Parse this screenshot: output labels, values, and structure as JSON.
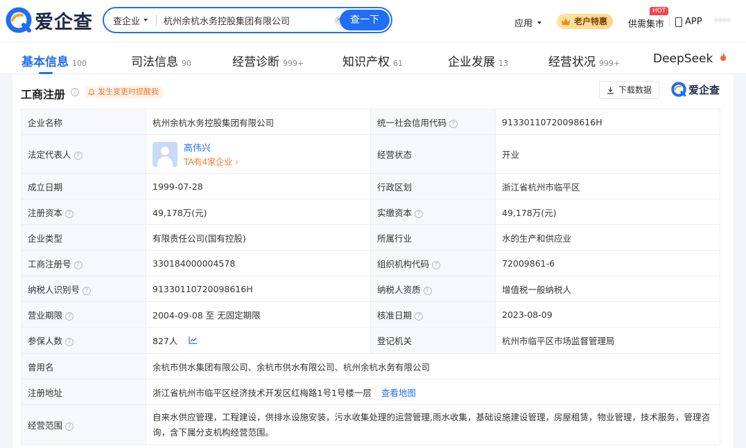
{
  "header": {
    "logo_text": "爱企查",
    "search_type": "查企业",
    "search_value": "杭州余杭水务控股集团有限公司",
    "search_button": "查一下",
    "nav_app": "应用",
    "nav_oldcust": "老户特惠",
    "nav_supply": "供需集市",
    "hot_badge": "HOT",
    "nav_appdl": "APP",
    "nav_user": "****"
  },
  "tabs": [
    {
      "label": "基本信息",
      "count": "100"
    },
    {
      "label": "司法信息",
      "count": "90"
    },
    {
      "label": "经营诊断",
      "count": "999+"
    },
    {
      "label": "知识产权",
      "count": "61"
    },
    {
      "label": "企业发展",
      "count": "13"
    },
    {
      "label": "经营状况",
      "count": "999+"
    },
    {
      "label": "DeepSeek",
      "count": ""
    }
  ],
  "section": {
    "title": "工商注册",
    "remind": "发生变更时提醒我",
    "download": "下载数据",
    "brand": "爱企查"
  },
  "info": {
    "company_name_label": "企业名称",
    "company_name": "杭州余杭水务控股集团有限公司",
    "credit_code_label": "统一社会信用代码",
    "credit_code": "91330110720098616H",
    "legal_rep_label": "法定代表人",
    "legal_rep_name": "高伟兴",
    "legal_rep_sub": "TA有4家企业",
    "status_label": "经营状态",
    "status": "开业",
    "founded_label": "成立日期",
    "founded": "1999-07-28",
    "region_label": "行政区划",
    "region": "浙江省杭州市临平区",
    "reg_capital_label": "注册资本",
    "reg_capital": "49,178万(元)",
    "paid_capital_label": "实缴资本",
    "paid_capital": "49,178万(元)",
    "type_label": "企业类型",
    "type": "有限责任公司(国有控股)",
    "industry_label": "所属行业",
    "industry": "水的生产和供应业",
    "reg_no_label": "工商注册号",
    "reg_no": "330184000004578",
    "org_code_label": "组织机构代码",
    "org_code": "72009861-6",
    "taxpayer_id_label": "纳税人识别号",
    "taxpayer_id": "91330110720098616H",
    "taxpayer_qual_label": "纳税人资质",
    "taxpayer_qual": "增值税一般纳税人",
    "term_label": "营业期限",
    "term": "2004-09-08 至 无固定期限",
    "approved_label": "核准日期",
    "approved": "2023-08-09",
    "insured_label": "参保人数",
    "insured": "827人",
    "authority_label": "登记机关",
    "authority": "杭州市临平区市场监督管理局",
    "former_names_label": "曾用名",
    "former_names": "余杭市供水集团有限公司、余杭市供水有限公司、杭州余杭水务有限公司",
    "address_label": "注册地址",
    "address": "浙江省杭州市临平区经济技术开发区红梅路1号1号楼一层",
    "map_link": "查看地图",
    "scope_label": "经营范围",
    "scope": "自来水供应管理，工程建设，供排水设施安装，污水收集处理的运营管理,雨水收集，基础设施建设管理，房屋租赁，物业管理，技术服务，管理咨询，含下属分支机构经营范围。"
  },
  "colors": {
    "brand_blue": "#1f6ef5",
    "accent_orange": "#f17a2b",
    "hot_red": "#f5464b"
  }
}
